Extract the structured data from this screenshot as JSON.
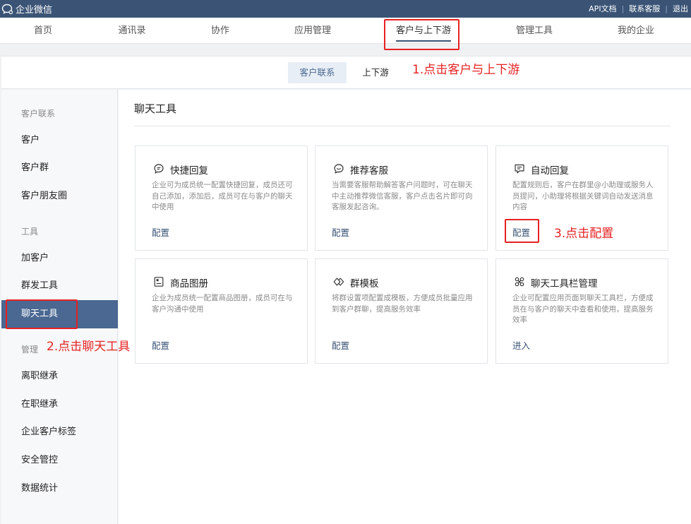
{
  "topbar": {
    "logo_text": "企业微信",
    "links": [
      "API文档",
      "联系客服",
      "退出"
    ]
  },
  "nav": {
    "items": [
      "首页",
      "通讯录",
      "协作",
      "应用管理",
      "客户与上下游",
      "管理工具",
      "我的企业"
    ],
    "active": "客户与上下游"
  },
  "subnav": {
    "tabs": [
      "客户联系",
      "上下游"
    ],
    "active": "客户联系"
  },
  "sidebar": {
    "group1": "客户联系",
    "items1": [
      "客户",
      "客户群",
      "客户朋友圈"
    ],
    "group2": "工具",
    "items2": [
      "加客户",
      "群发工具",
      "聊天工具"
    ],
    "group3": "管理",
    "items3": [
      "离职继承",
      "在职继承",
      "企业客户标签",
      "安全管控",
      "数据统计"
    ],
    "active": "聊天工具"
  },
  "content": {
    "title": "聊天工具",
    "cards": [
      {
        "icon": "quick-reply-icon",
        "title": "快捷回复",
        "desc": "企业可为成员统一配置快捷回复，成员还可自己添加，添加后，成员可在与客户的聊天中使用",
        "link": "配置"
      },
      {
        "icon": "recommend-service-icon",
        "title": "推荐客服",
        "desc": "当需要客服帮助解答客户问题时，可在聊天中主动推荐微信客服，客户点击名片即可向客服发起咨询。",
        "link": "配置"
      },
      {
        "icon": "auto-reply-icon",
        "title": "自动回复",
        "desc": "配置规则后，客户在群里@小助理或服务人员提问，小助理将根据关键词自动发送消息内容",
        "link": "配置"
      },
      {
        "icon": "product-album-icon",
        "title": "商品图册",
        "desc": "企业为成员统一配置商品图册，成员可在与客户沟通中使用",
        "link": "配置"
      },
      {
        "icon": "group-template-icon",
        "title": "群模板",
        "desc": "将群设置项配置成模板，方便成员批量应用到客户群聊，提高服务效率",
        "link": "配置"
      },
      {
        "icon": "toolbar-manage-icon",
        "title": "聊天工具栏管理",
        "desc": "企业可配置应用页面到聊天工具栏，方便成员在与客户的聊天中查看和使用，提高服务效率",
        "link": "进入"
      }
    ]
  },
  "annotations": {
    "step1": "1.点击客户与上下游",
    "step2": "2.点击聊天工具",
    "step3": "3.点击配置",
    "color": "#e62121"
  }
}
